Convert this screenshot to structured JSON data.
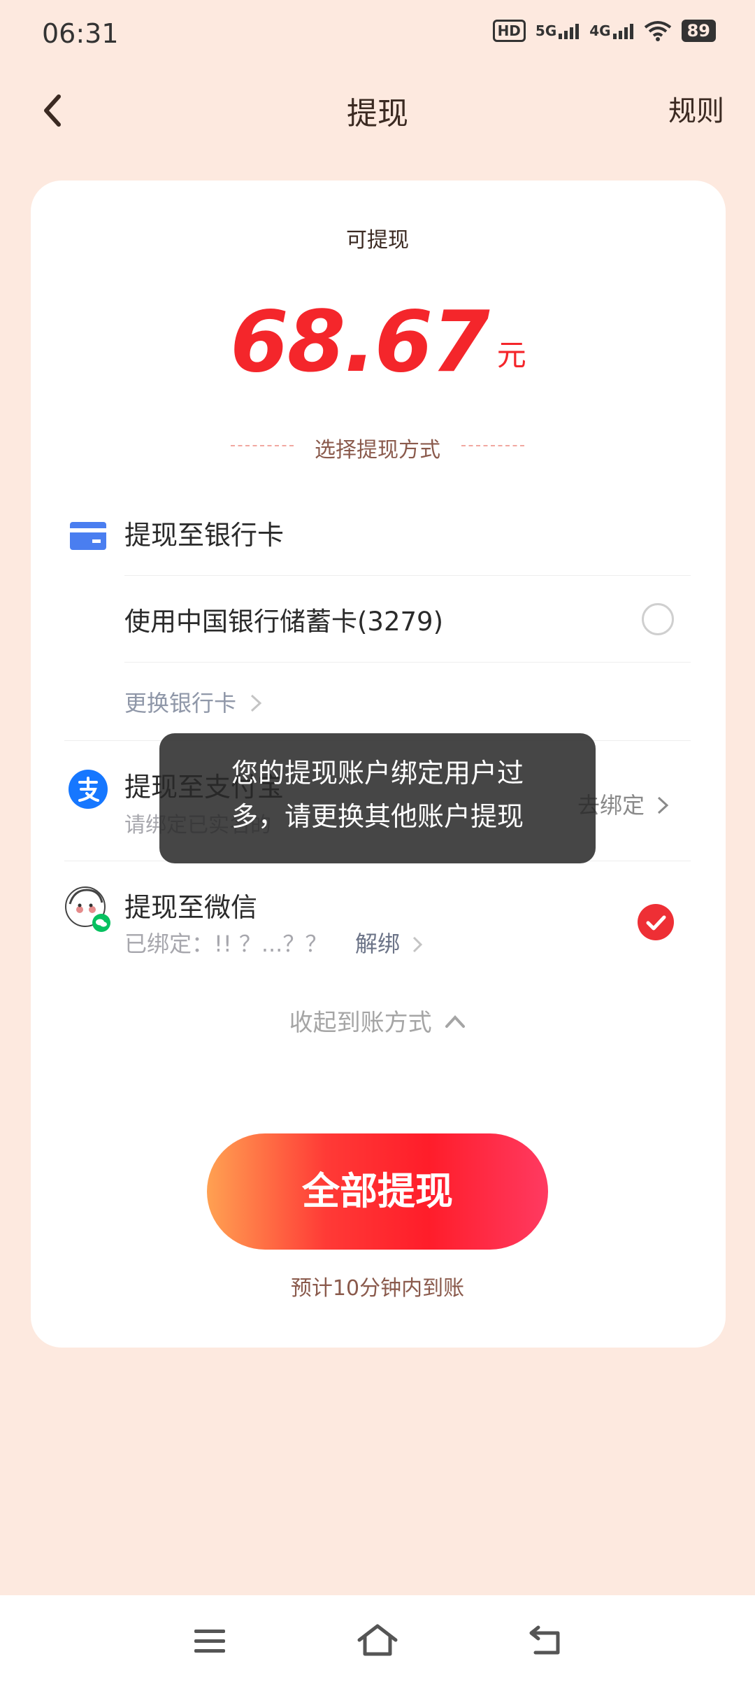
{
  "status_bar": {
    "time": "06:31",
    "hd": "HD",
    "net1": "5G",
    "net2": "4G",
    "battery": "89"
  },
  "header": {
    "title": "提现",
    "rules_label": "规则"
  },
  "balance": {
    "label": "可提现",
    "amount": "68.67",
    "unit": "元"
  },
  "method_section_title": "选择提现方式",
  "bank": {
    "title": "提现至银行卡",
    "card_option": "使用中国银行储蓄卡(3279)",
    "change_link": "更换银行卡"
  },
  "alipay": {
    "title": "提现至支付宝",
    "subtitle": "请绑定已实名的",
    "bind_action": "去绑定"
  },
  "wechat": {
    "title": "提现至微信",
    "subtitle": "已绑定：!!  ？...？？",
    "unbind_action": "解绑"
  },
  "collapse_label": "收起到账方式",
  "cta": {
    "label": "全部提现",
    "eta": "预计10分钟内到账"
  },
  "toast": {
    "line1": "您的提现账户绑定用户过",
    "line2": "多，请更换其他账户提现"
  },
  "colors": {
    "accent": "#f4262b",
    "background": "#fde9df",
    "bank_icon": "#4a7ef0",
    "alipay_icon": "#1677ff",
    "wechat": "#07c160"
  }
}
